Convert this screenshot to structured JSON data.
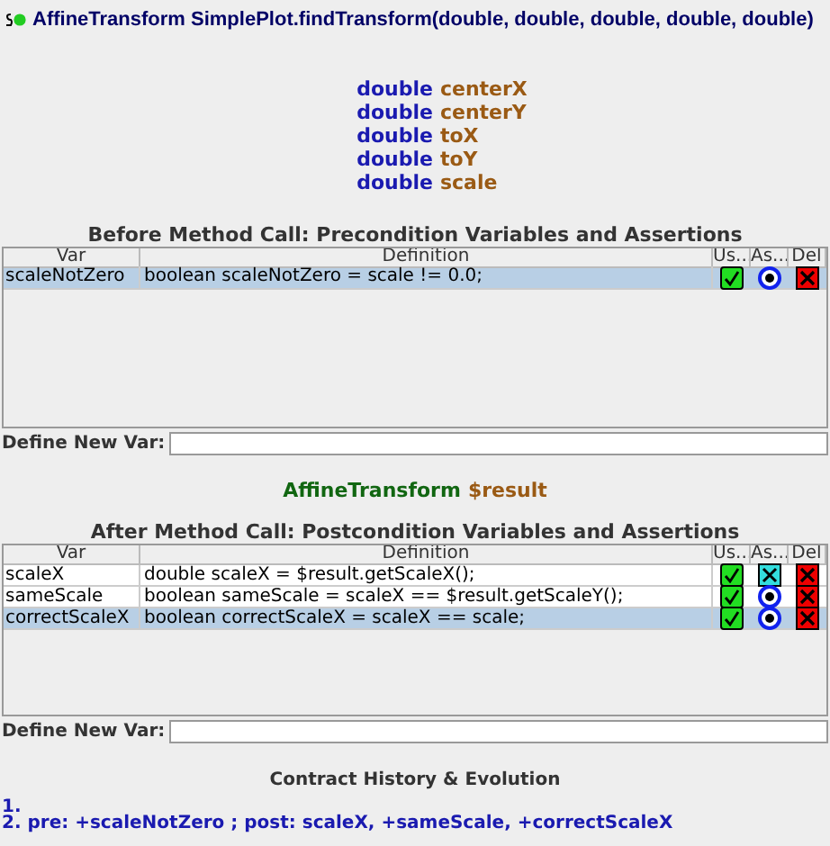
{
  "method": {
    "signature": "AffineTransform SimplePlot.findTransform(double, double, double, double, double)"
  },
  "parameters": [
    {
      "type": "double",
      "name": "centerX"
    },
    {
      "type": "double",
      "name": "centerY"
    },
    {
      "type": "double",
      "name": "toX"
    },
    {
      "type": "double",
      "name": "toY"
    },
    {
      "type": "double",
      "name": "scale"
    }
  ],
  "precondition": {
    "title": "Before Method Call: Precondition Variables and Assertions",
    "columns": [
      "Var",
      "Definition",
      "Us...",
      "As...",
      "Del"
    ],
    "rows": [
      {
        "var": "scaleNotZero",
        "definition": "boolean scaleNotZero = scale != 0.0;",
        "used": true,
        "asserted": true,
        "selected": true
      }
    ],
    "define_label": "Define New Var:"
  },
  "result": {
    "type": "AffineTransform",
    "name": "$result"
  },
  "postcondition": {
    "title": "After Method Call: Postcondition Variables and Assertions",
    "columns": [
      "Var",
      "Definition",
      "Us...",
      "As...",
      "Del"
    ],
    "rows": [
      {
        "var": "scaleX",
        "definition": "double scaleX = $result.getScaleX();",
        "used": true,
        "asserted": false,
        "selected": false
      },
      {
        "var": "sameScale",
        "definition": "boolean sameScale = scaleX == $result.getScaleY();",
        "used": true,
        "asserted": true,
        "selected": false
      },
      {
        "var": "correctScaleX",
        "definition": "boolean correctScaleX = scaleX == scale;",
        "used": true,
        "asserted": true,
        "selected": true
      }
    ],
    "define_label": "Define New Var:"
  },
  "history": {
    "title": "Contract History & Evolution",
    "entries": [
      "1.",
      "2. pre: +scaleNotZero ; post: scaleX, +sameScale, +correctScaleX"
    ]
  }
}
